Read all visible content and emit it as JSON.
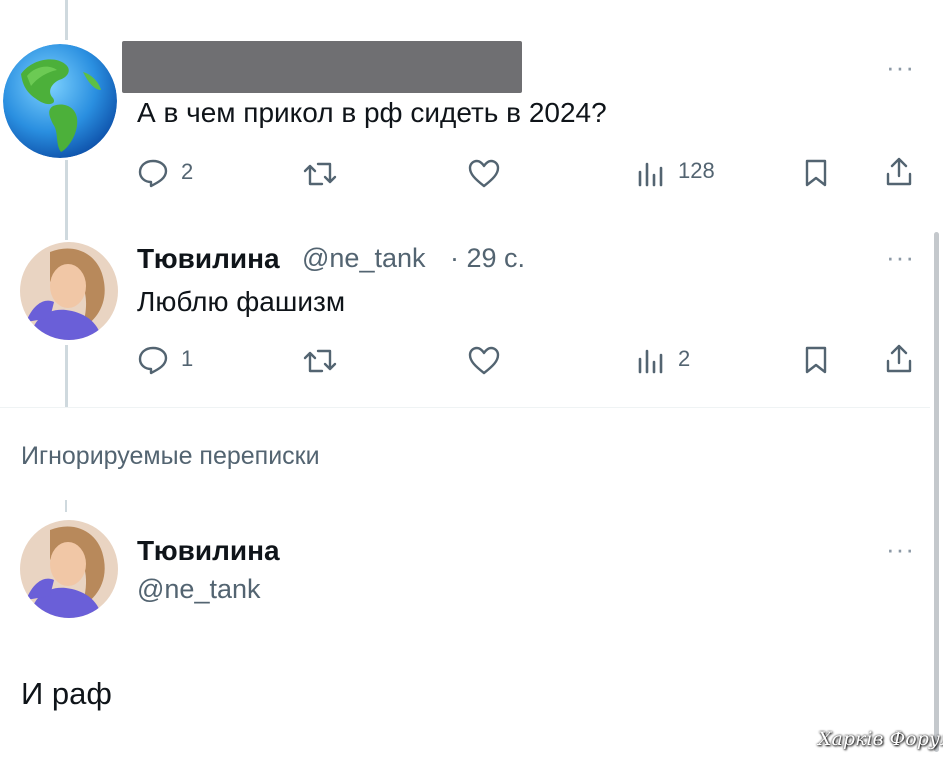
{
  "tweets": [
    {
      "avatar": "globe-avatar",
      "text": "А в чем прикол в рф сидеть в 2024?",
      "actions": {
        "replies": "2",
        "reposts": "",
        "likes": "",
        "views": "128"
      }
    },
    {
      "avatar": "woman-avatar",
      "display_name": "Тювилина",
      "handle": "@ne_tank",
      "time": "· 29 с.",
      "text": "Люблю фашизм",
      "actions": {
        "replies": "1",
        "reposts": "",
        "likes": "",
        "views": "2"
      }
    }
  ],
  "ignored_section": {
    "title": "Игнорируемые переписки"
  },
  "focused_tweet": {
    "avatar": "woman-avatar",
    "display_name": "Тювилина",
    "handle": "@ne_tank",
    "text": "И раф"
  },
  "more_label": "···",
  "watermark": "Харків Форум",
  "colors": {
    "text": "#0f1419",
    "secondary": "#536471",
    "line": "#cfd9de"
  }
}
